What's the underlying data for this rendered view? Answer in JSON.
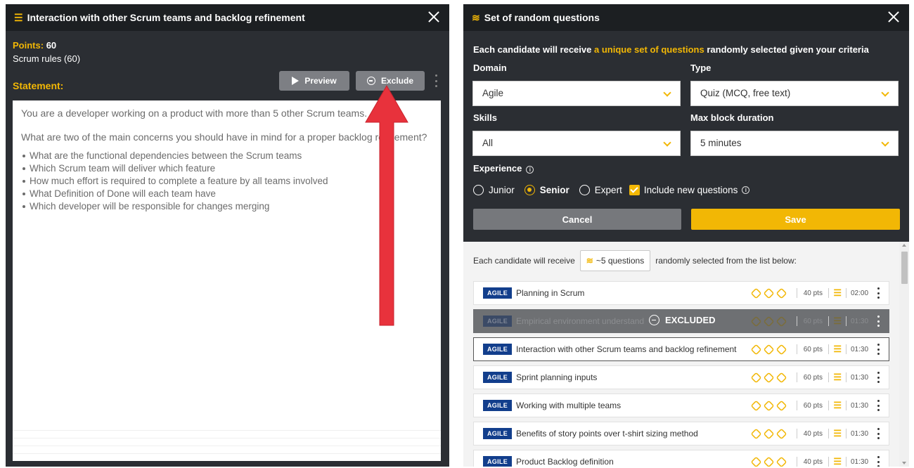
{
  "left": {
    "title": "Interaction with other Scrum teams and backlog refinement",
    "points_label": "Points:",
    "points_value": "60",
    "rules": "Scrum rules (60)",
    "statement_label": "Statement:",
    "preview_label": "Preview",
    "exclude_label": "Exclude",
    "statement": {
      "p1": "You are a developer working on a product with more than 5 other Scrum teams.",
      "p2": "What are two of the main concerns you should have in mind for a proper backlog refinement?",
      "bullets": [
        "What are the functional dependencies between the Scrum teams",
        "Which Scrum team will deliver which feature",
        "How much effort is required to complete a feature by all teams involved",
        "What Definition of Done will each team have",
        "Which developer will be responsible for changes merging"
      ]
    }
  },
  "right": {
    "title": "Set of random questions",
    "intro_prefix": "Each candidate will receive ",
    "intro_highlight": "a unique set of questions",
    "intro_suffix": " randomly selected given your criteria",
    "domain_label": "Domain",
    "domain_value": "Agile",
    "type_label": "Type",
    "type_value": "Quiz (MCQ, free text)",
    "skills_label": "Skills",
    "skills_value": "All",
    "duration_label": "Max block duration",
    "duration_value": "5 minutes",
    "experience_label": "Experience",
    "experience_options": [
      "Junior",
      "Senior",
      "Expert"
    ],
    "experience_selected": "Senior",
    "include_new_label": "Include new questions",
    "cancel_label": "Cancel",
    "save_label": "Save",
    "list_intro_prefix": "Each candidate will receive",
    "list_count": "~5 questions",
    "list_intro_suffix": "randomly selected from the list below:",
    "excluded_label": "EXCLUDED",
    "questions": [
      {
        "tag": "AGILE",
        "title": "Planning in Scrum",
        "pts": "40 pts",
        "dur": "02:00"
      },
      {
        "tag": "AGILE",
        "title": "Empirical environment understand",
        "pts": "60 pts",
        "dur": "01:30"
      },
      {
        "tag": "AGILE",
        "title": "Interaction with other Scrum teams and backlog refinement",
        "pts": "60 pts",
        "dur": "01:30"
      },
      {
        "tag": "AGILE",
        "title": "Sprint planning inputs",
        "pts": "60 pts",
        "dur": "01:30"
      },
      {
        "tag": "AGILE",
        "title": "Working with multiple teams",
        "pts": "60 pts",
        "dur": "01:30"
      },
      {
        "tag": "AGILE",
        "title": "Benefits of story points over t-shirt sizing method",
        "pts": "40 pts",
        "dur": "01:30"
      },
      {
        "tag": "AGILE",
        "title": "Product Backlog definition",
        "pts": "40 pts",
        "dur": "01:30"
      }
    ]
  },
  "colors": {
    "accent": "#f2b705",
    "panel": "#2b2e33",
    "header": "#1c1f22",
    "tag": "#123e8c",
    "arrow": "#e8323c"
  }
}
